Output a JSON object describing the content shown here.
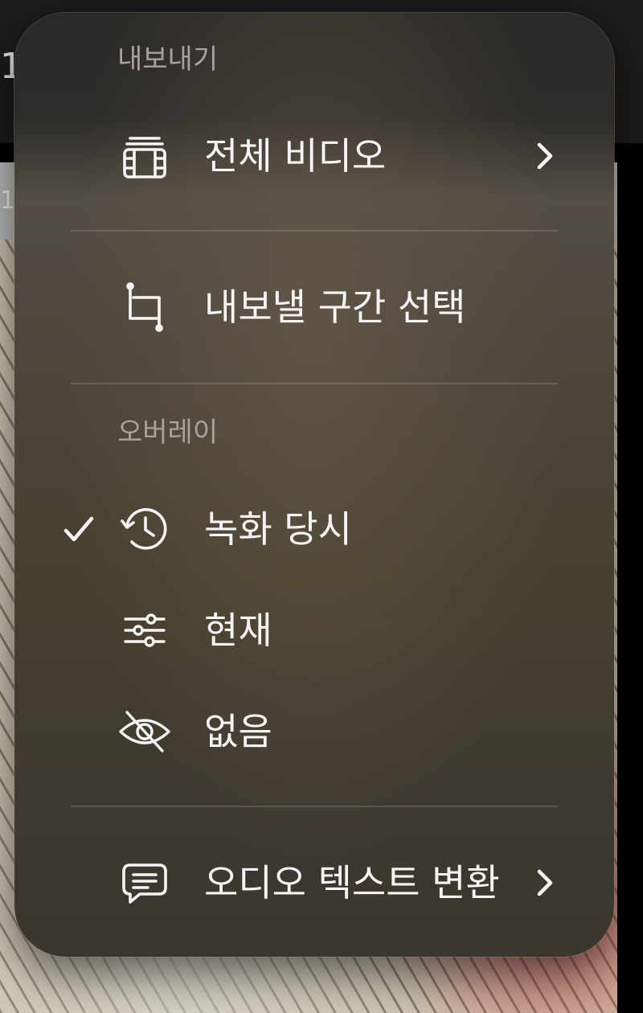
{
  "background": {
    "topbar_char": "1",
    "strip_char": "1"
  },
  "menu": {
    "export_section": {
      "header": "내보내기",
      "items": [
        {
          "label": "전체 비디오",
          "icon": "film-stack-icon",
          "has_submenu": true
        },
        {
          "label": "내보낼 구간 선택",
          "icon": "crop-icon",
          "has_submenu": false
        }
      ]
    },
    "overlay_section": {
      "header": "오버레이",
      "items": [
        {
          "label": "녹화 당시",
          "icon": "history-clock-icon",
          "checked": true
        },
        {
          "label": "현재",
          "icon": "sliders-icon",
          "checked": false
        },
        {
          "label": "없음",
          "icon": "eye-slash-icon",
          "checked": false
        }
      ]
    },
    "transcribe_item": {
      "label": "오디오 텍스트 변환",
      "icon": "speech-bubble-icon",
      "has_submenu": true
    }
  },
  "colors": {
    "menu_text": "#f5f5f5",
    "section_header": "#a7a39c",
    "menu_border": "#b4966e"
  }
}
